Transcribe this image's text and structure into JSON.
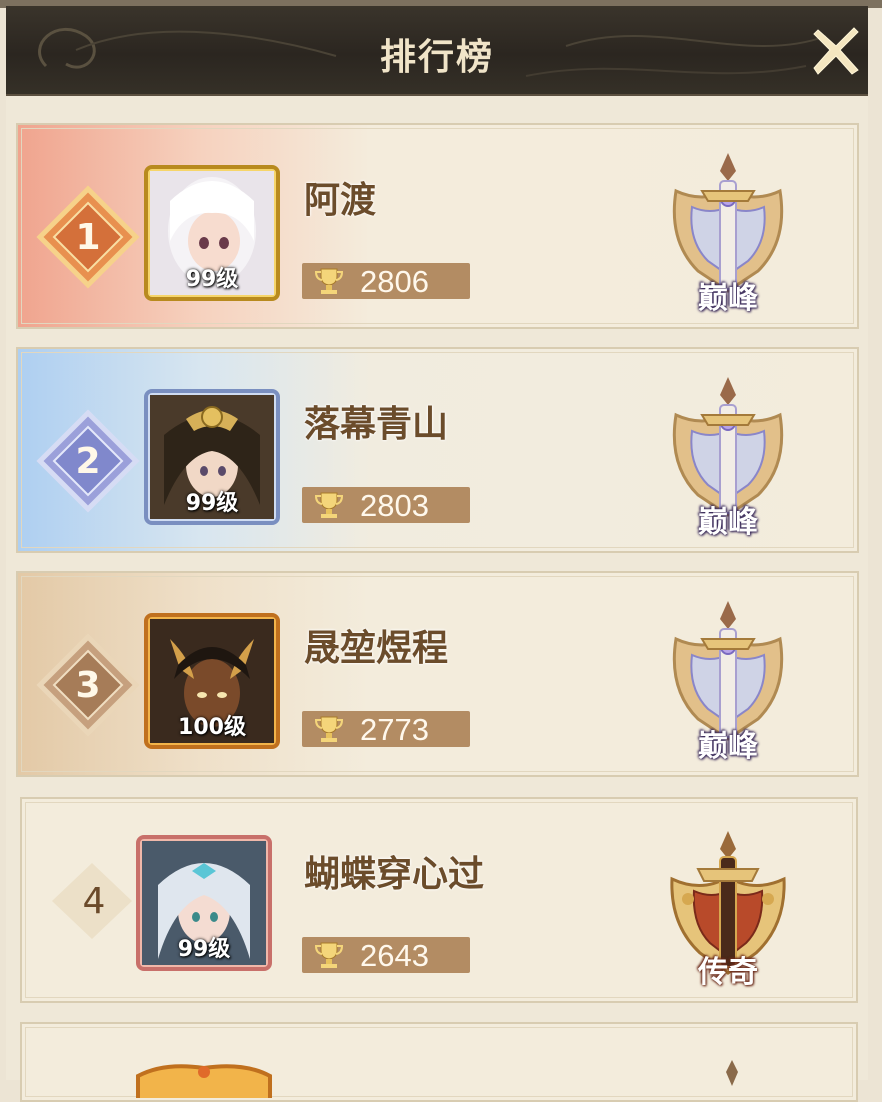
{
  "header": {
    "title": "排行榜"
  },
  "colors": {
    "header_bg": "#2b2620",
    "title": "#f0e4c8",
    "name": "#6b4c2b",
    "score_bar": "#b38c63",
    "rank1": "#e8904f",
    "rank2": "#8f95d6",
    "rank3": "#b08a68",
    "tier_peak": "#8a86c9",
    "tier_legend": "#b84a2a"
  },
  "rankings": [
    {
      "rank": "1",
      "name": "阿渡",
      "level": "99级",
      "score": "2806",
      "tier": "巅峰",
      "tier_icon": "peak-sword-emblem-icon"
    },
    {
      "rank": "2",
      "name": "落幕青山",
      "level": "99级",
      "score": "2803",
      "tier": "巅峰",
      "tier_icon": "peak-sword-emblem-icon"
    },
    {
      "rank": "3",
      "name": "晟堃煜程",
      "level": "100级",
      "score": "2773",
      "tier": "巅峰",
      "tier_icon": "peak-sword-emblem-icon"
    },
    {
      "rank": "4",
      "name": "蝴蝶穿心过",
      "level": "99级",
      "score": "2643",
      "tier": "传奇",
      "tier_icon": "legend-sword-emblem-icon"
    }
  ]
}
